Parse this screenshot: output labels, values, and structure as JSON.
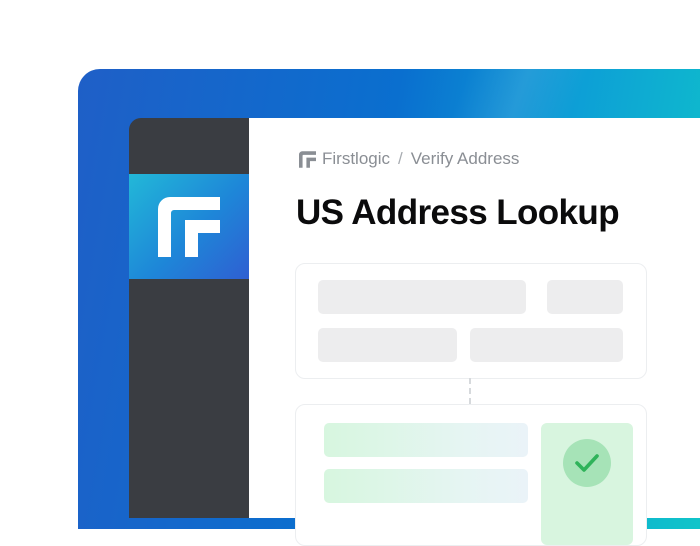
{
  "breadcrumb": {
    "brand": "Firstlogic",
    "separator": "/",
    "page": "Verify Address"
  },
  "page": {
    "title": "US Address Lookup"
  },
  "icons": {
    "brand_logo": "firstlogic-f-logo-icon",
    "breadcrumb_logo": "firstlogic-f-logo-icon",
    "verified": "check-icon"
  },
  "colors": {
    "frame_start": "#1f5fc7",
    "frame_end": "#10c8c8",
    "sidebar": "#3a3d42",
    "logo_tile_start": "#22b8d8",
    "logo_tile_end": "#2f5fd2",
    "placeholder": "#ededee",
    "success_light": "#d8f5df",
    "success": "#2fb35a"
  }
}
